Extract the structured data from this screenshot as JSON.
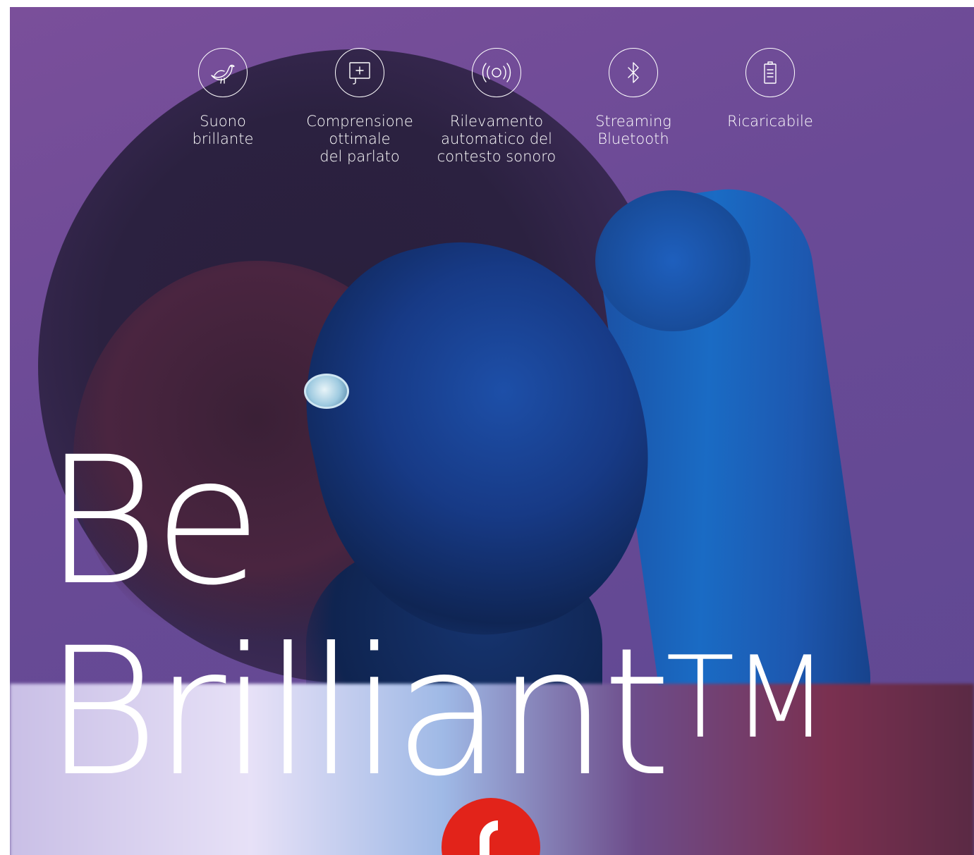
{
  "features": [
    {
      "icon": "bird-icon",
      "label": "Suono\nbrillante"
    },
    {
      "icon": "speech-bubble-plus-icon",
      "label": "Comprensione\nottimale\ndel parlato"
    },
    {
      "icon": "sound-waves-icon",
      "label": "Rilevamento\nautomatico del\ncontesto sonoro"
    },
    {
      "icon": "bluetooth-icon",
      "label": "Streaming\nBluetooth"
    },
    {
      "icon": "battery-icon",
      "label": "Ricaricabile"
    }
  ],
  "headline": {
    "line1": "Be",
    "line2": "Brilliant",
    "trademark": "TM"
  },
  "colors": {
    "background": "#6e4b97",
    "text": "#ffffff",
    "brand_red": "#e2231a"
  },
  "logo": {
    "icon": "brand-logo-icon"
  }
}
